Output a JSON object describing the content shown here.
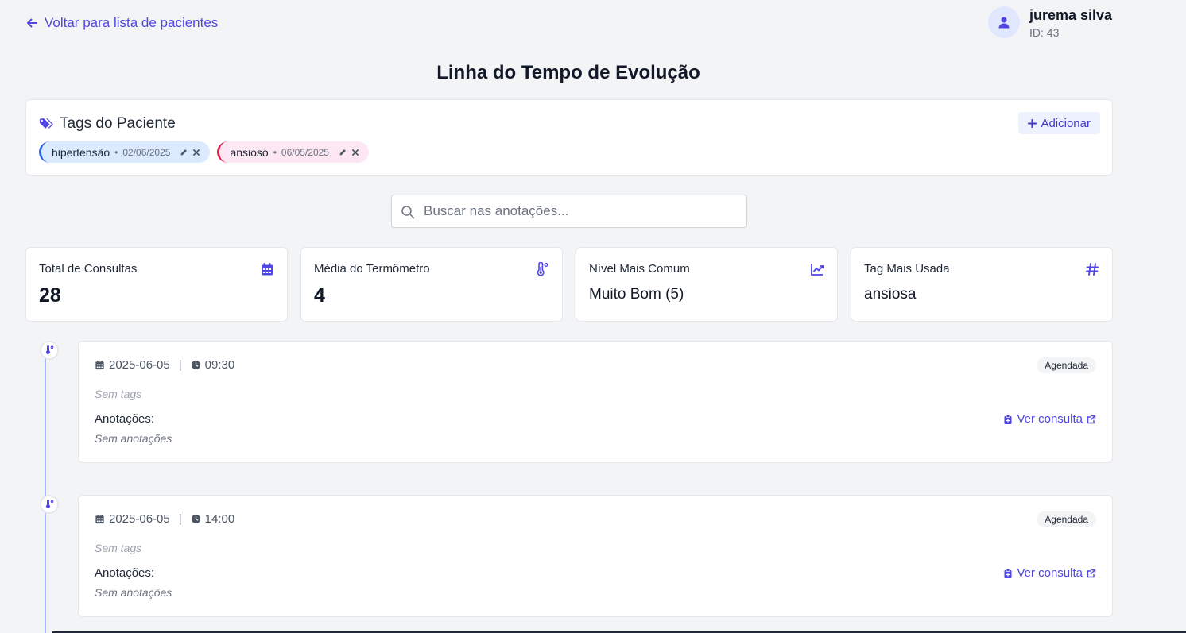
{
  "nav": {
    "back_label": "Voltar para lista de pacientes"
  },
  "user": {
    "name": "jurema silva",
    "id_label": "ID: 43"
  },
  "page": {
    "title": "Linha do Tempo de Evolução"
  },
  "tags_card": {
    "title": "Tags do Paciente",
    "add_label": "Adicionar",
    "tags": [
      {
        "name": "hipertensão",
        "date": "02/06/2025",
        "color": "#2563eb"
      },
      {
        "name": "ansioso",
        "date": "06/05/2025",
        "color": "#e11d48"
      }
    ]
  },
  "search": {
    "placeholder": "Buscar nas anotações..."
  },
  "stats": [
    {
      "label": "Total de Consultas",
      "value": "28",
      "icon": "calendar-icon"
    },
    {
      "label": "Média do Termômetro",
      "value": "4",
      "icon": "thermometer-icon"
    },
    {
      "label": "Nível Mais Comum",
      "value": "Muito Bom (5)",
      "icon": "chart-line-icon"
    },
    {
      "label": "Tag Mais Usada",
      "value": "ansiosa",
      "icon": "hashtag-icon"
    }
  ],
  "timeline": [
    {
      "date": "2025-06-05",
      "time": "09:30",
      "status": "Agendada",
      "tags_text": "Sem tags",
      "notes_label": "Anotações:",
      "notes": "Sem anotações",
      "link_label": "Ver consulta"
    },
    {
      "date": "2025-06-05",
      "time": "14:00",
      "status": "Agendada",
      "tags_text": "Sem tags",
      "notes_label": "Anotações:",
      "notes": "Sem anotações",
      "link_label": "Ver consulta"
    }
  ],
  "colors": {
    "accent": "#4f46e5",
    "timeline_line": "#a5b4fc",
    "background": "#f3f4f6"
  }
}
